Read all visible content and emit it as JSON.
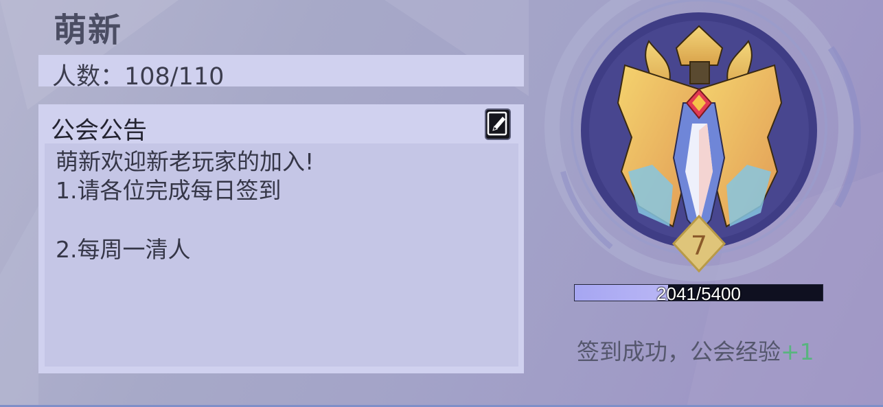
{
  "guild": {
    "name": "萌新",
    "members_label": "人数：108/110",
    "level": "7"
  },
  "notice": {
    "title": "公会公告",
    "lines": [
      "萌新欢迎新老玩家的加入!",
      "1.请各位完成每日签到",
      "",
      "2.每周一清人"
    ]
  },
  "experience": {
    "label": "2041/5400",
    "current": 2041,
    "max": 5400
  },
  "signin": {
    "message": "签到成功，公会经验",
    "bonus": "+1"
  },
  "icons": {
    "edit": "pencil-edit-icon",
    "emblem": "winged-crown-emblem-icon"
  },
  "colors": {
    "panel": "#d0d1ef",
    "progress_fill": "#a6a6f2",
    "bonus_text": "#58b47f",
    "emblem_gold": "#e7bd52"
  }
}
